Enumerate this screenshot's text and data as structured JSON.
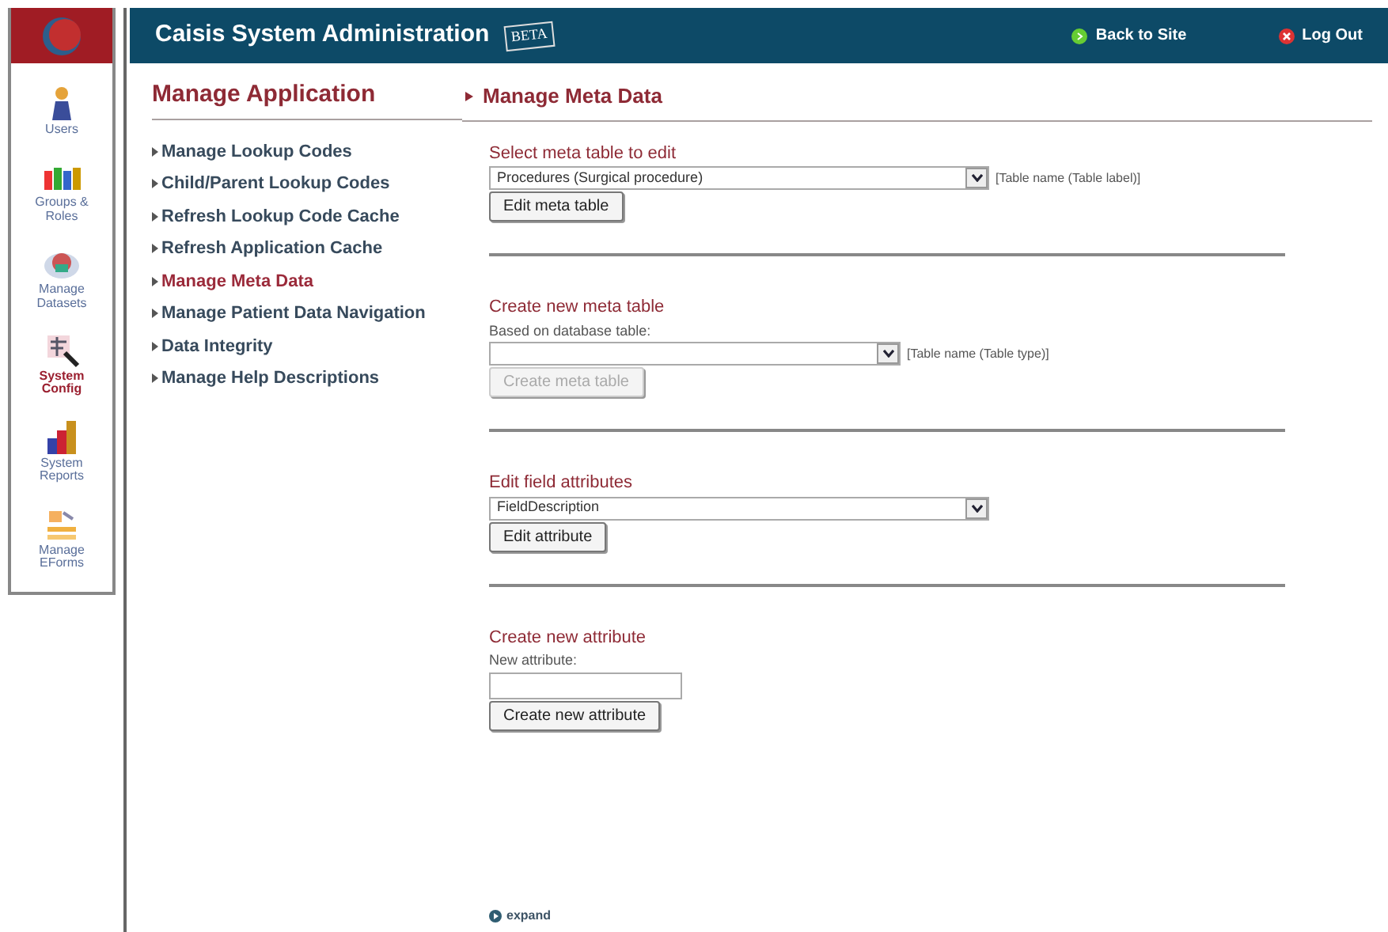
{
  "sidebar": {
    "items": [
      {
        "label": "Users",
        "selected": false
      },
      {
        "label": "Groups & Roles",
        "selected": false
      },
      {
        "label": "Manage Datasets",
        "selected": false
      },
      {
        "label": "System Config",
        "selected": true
      },
      {
        "label": "System Reports",
        "selected": false
      },
      {
        "label": "Manage EForms",
        "selected": false
      }
    ]
  },
  "header": {
    "title": "Caisis System Administration",
    "badge": "BETA",
    "links": [
      {
        "label": "Back to Site",
        "kind": "back"
      },
      {
        "label": "Log Out",
        "kind": "logout"
      }
    ]
  },
  "menu": {
    "title": "Manage Application",
    "items": [
      {
        "label": "Manage Lookup Codes",
        "selected": false
      },
      {
        "label": "Child/Parent Lookup Codes",
        "selected": false
      },
      {
        "label": "Refresh Lookup Code Cache",
        "selected": false
      },
      {
        "label": "Refresh Application Cache",
        "selected": false
      },
      {
        "label": "Manage Meta Data",
        "selected": true
      },
      {
        "label": "Manage Patient Data Navigation",
        "selected": false
      },
      {
        "label": "Data Integrity",
        "selected": false
      },
      {
        "label": "Manage Help Descriptions",
        "selected": false
      }
    ]
  },
  "main": {
    "title": "Manage Meta Data",
    "sections": [
      {
        "heading": "Select meta table to edit",
        "field": {
          "kind": "select",
          "value": "Procedures (Surgical procedure)"
        },
        "hint": "[Table name (Table label)]",
        "button": {
          "label": "Edit meta table",
          "disabled": false
        }
      },
      {
        "heading": "Create new meta table",
        "field_label": "Based on database table:",
        "field": {
          "kind": "select"
        },
        "hint": "[Table name (Table type)]",
        "button": {
          "label": "Create meta table",
          "disabled": true
        }
      },
      {
        "heading": "Edit field attributes",
        "field": {
          "kind": "select",
          "value": "FieldDescription"
        },
        "button": {
          "label": "Edit attribute",
          "disabled": false
        }
      },
      {
        "heading": "Create new attribute",
        "field_label": "New attribute:",
        "field": {
          "kind": "text"
        },
        "button": {
          "label": "Create new attribute",
          "disabled": false
        }
      }
    ]
  },
  "footer": {
    "expand": "expand"
  }
}
